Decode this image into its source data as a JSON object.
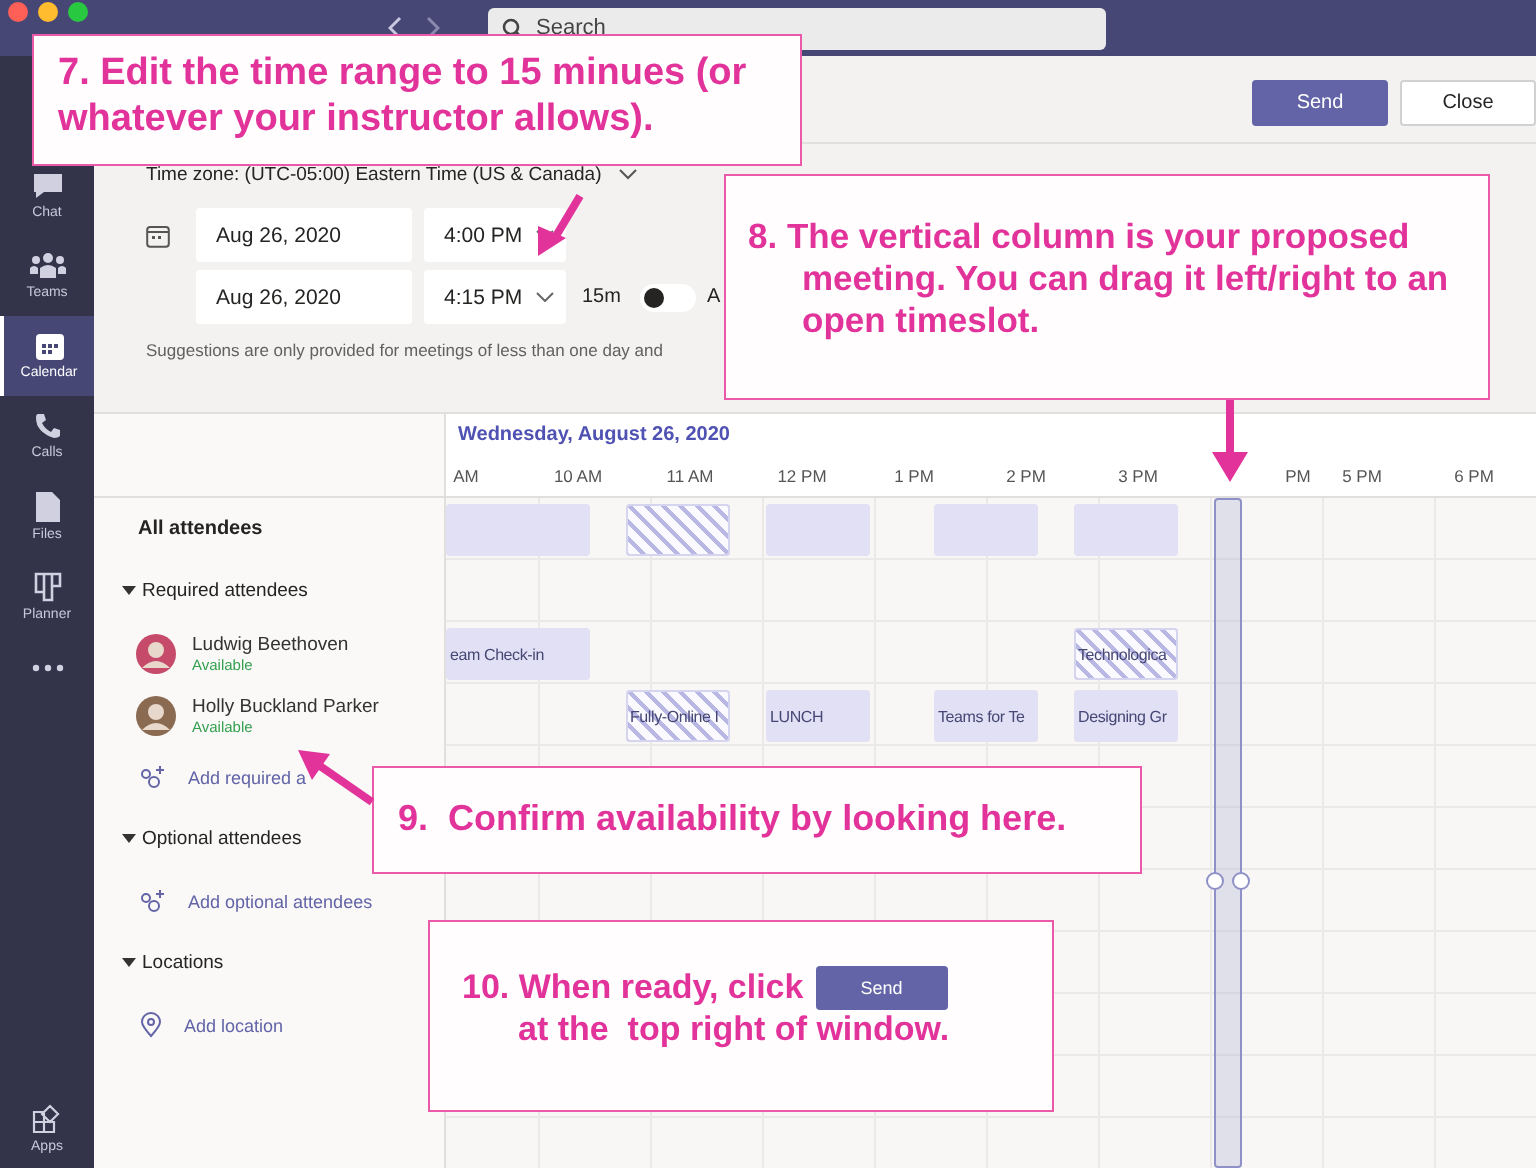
{
  "titlebar": {
    "search_placeholder": "Search"
  },
  "rail": [
    {
      "label": "Chat",
      "selected": false
    },
    {
      "label": "Teams",
      "selected": false
    },
    {
      "label": "Calendar",
      "selected": true
    },
    {
      "label": "Calls",
      "selected": false
    },
    {
      "label": "Files",
      "selected": false
    },
    {
      "label": "Planner",
      "selected": false
    }
  ],
  "rail_bottom": {
    "label": "Apps"
  },
  "header_buttons": [
    {
      "label": "Send",
      "kind": "primary"
    },
    {
      "label": "Close",
      "kind": "secondary"
    }
  ],
  "time_zone": "Time zone: (UTC-05:00) Eastern Time (US & Canada)",
  "start": {
    "date": "Aug 26, 2020",
    "time": "4:00 PM"
  },
  "end": {
    "date": "Aug 26, 2020",
    "time": "4:15 PM"
  },
  "duration": "15m",
  "all_day": {
    "on": false,
    "label": "A"
  },
  "suggestion_note": "Suggestions are only provided for meetings of less than one day and",
  "schedule": {
    "date_heading": "Wednesday, August 26, 2020",
    "hour_labels": [
      "AM",
      "10 AM",
      "11 AM",
      "12 PM",
      "1 PM",
      "2 PM",
      "3 PM",
      "PM",
      "5 PM",
      "6 PM"
    ],
    "rows": [
      {
        "kind": "summary",
        "label": "All attendees",
        "events": [
          {
            "tentative": false
          },
          {
            "tentative": true
          },
          {
            "tentative": false
          },
          {
            "tentative": false
          },
          {
            "tentative": false
          }
        ]
      },
      {
        "kind": "section",
        "label": "Required attendees",
        "expanded": true
      },
      {
        "kind": "person",
        "label": "Ludwig Beethoven",
        "status": "Available",
        "events": [
          {
            "title": "eam Check-in",
            "tentative": false
          },
          {
            "title": "Technologica",
            "tentative": true
          }
        ]
      },
      {
        "kind": "person",
        "label": "Holly Buckland Parker",
        "status": "Available",
        "events": [
          {
            "title": "Fully-Online I",
            "tentative": true
          },
          {
            "title": "LUNCH",
            "tentative": false
          },
          {
            "title": "Teams for Te",
            "tentative": false
          },
          {
            "title": "Designing Gr",
            "tentative": false
          }
        ]
      },
      {
        "kind": "add_person",
        "label": "Add required a"
      },
      {
        "kind": "section",
        "label": "Optional attendees",
        "expanded": true
      },
      {
        "kind": "add_person",
        "label": "Add optional attendees"
      },
      {
        "kind": "section",
        "label": "Locations",
        "expanded": true
      },
      {
        "kind": "add_location",
        "label": "Add location"
      }
    ]
  },
  "callouts": [
    {
      "text": "7. Edit the time range to 15 minues (or whatever your instructor allows)."
    },
    {
      "text": "8. The vertical column is your proposed meeting. You can drag it left/right to an open timeslot."
    },
    {
      "text": "9.  Confirm availability by looking here."
    },
    {
      "text": "10. When ready, click",
      "button": "Send",
      "text_after": "at the  top right of window."
    }
  ]
}
